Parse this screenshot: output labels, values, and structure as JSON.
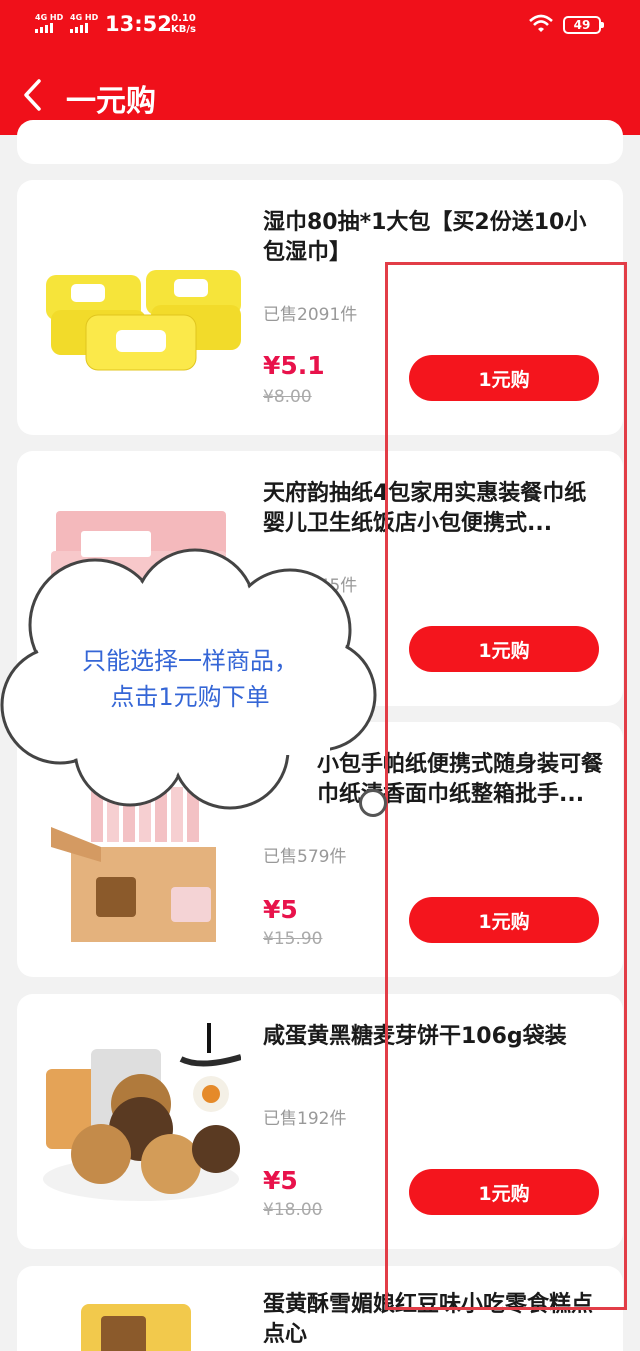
{
  "status_bar": {
    "signal1": "4G HD",
    "signal2": "4G HD",
    "time": "13:52",
    "speed_value": "0.10",
    "speed_unit": "KB/s",
    "battery": "49"
  },
  "header": {
    "title": "一元购",
    "back_icon": "chevron-left-icon"
  },
  "products": [
    {
      "name": "湿巾80抽*1大包【买2份送10小包湿巾】",
      "sold": "已售2091件",
      "price": "¥5.1",
      "original_price": "¥8.00",
      "button": "1元购"
    },
    {
      "name": "天府韵抽纸4包家用实惠装餐巾纸婴儿卫生纸饭店小包便携式...",
      "sold": "已售1245件",
      "price": "",
      "original_price": "",
      "button": "1元购"
    },
    {
      "name": "小包手帕纸便携式随身装可餐巾纸清香面巾纸整箱批手...",
      "sold": "已售579件",
      "price": "¥5",
      "original_price": "¥15.90",
      "button": "1元购"
    },
    {
      "name": "咸蛋黄黑糖麦芽饼干106g袋装",
      "sold": "已售192件",
      "price": "¥5",
      "original_price": "¥18.00",
      "button": "1元购"
    },
    {
      "name": "蛋黄酥雪媚娘红豆味小吃零食糕点点心",
      "sold": "",
      "price": "",
      "original_price": "",
      "button": ""
    }
  ],
  "tip_bubble": {
    "line1": "只能选择一样商品，",
    "line2": "点击1元购下单"
  },
  "colors": {
    "brand_red": "#f0101a",
    "price_red": "#e8124b",
    "tip_blue": "#3566d6"
  }
}
